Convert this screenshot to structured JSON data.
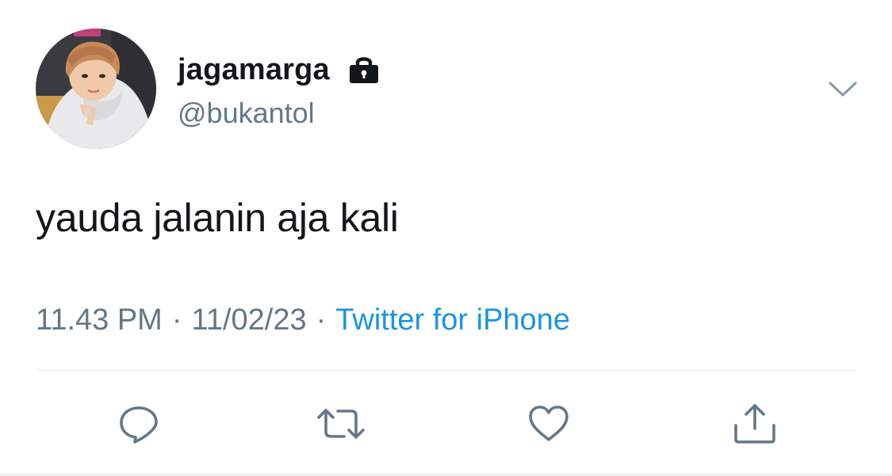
{
  "user": {
    "display_name": "jagamarga",
    "handle": "@bukantol",
    "protected_icon": "lock-icon",
    "avatar_alt": "avatar"
  },
  "tweet": {
    "text": "yauda jalanin aja kali",
    "time": "11.43 PM",
    "separator": "·",
    "date": "11/02/23",
    "source": "Twitter for iPhone"
  },
  "actions": [
    {
      "name": "reply",
      "icon": "speech-bubble-icon"
    },
    {
      "name": "retweet",
      "icon": "retweet-icon"
    },
    {
      "name": "like",
      "icon": "heart-icon"
    },
    {
      "name": "share",
      "icon": "share-icon"
    }
  ],
  "colors": {
    "text_primary": "#14171a",
    "text_secondary": "#657786",
    "link": "#1b95e0",
    "icon": "#657786",
    "divider": "#e1e8ed"
  }
}
